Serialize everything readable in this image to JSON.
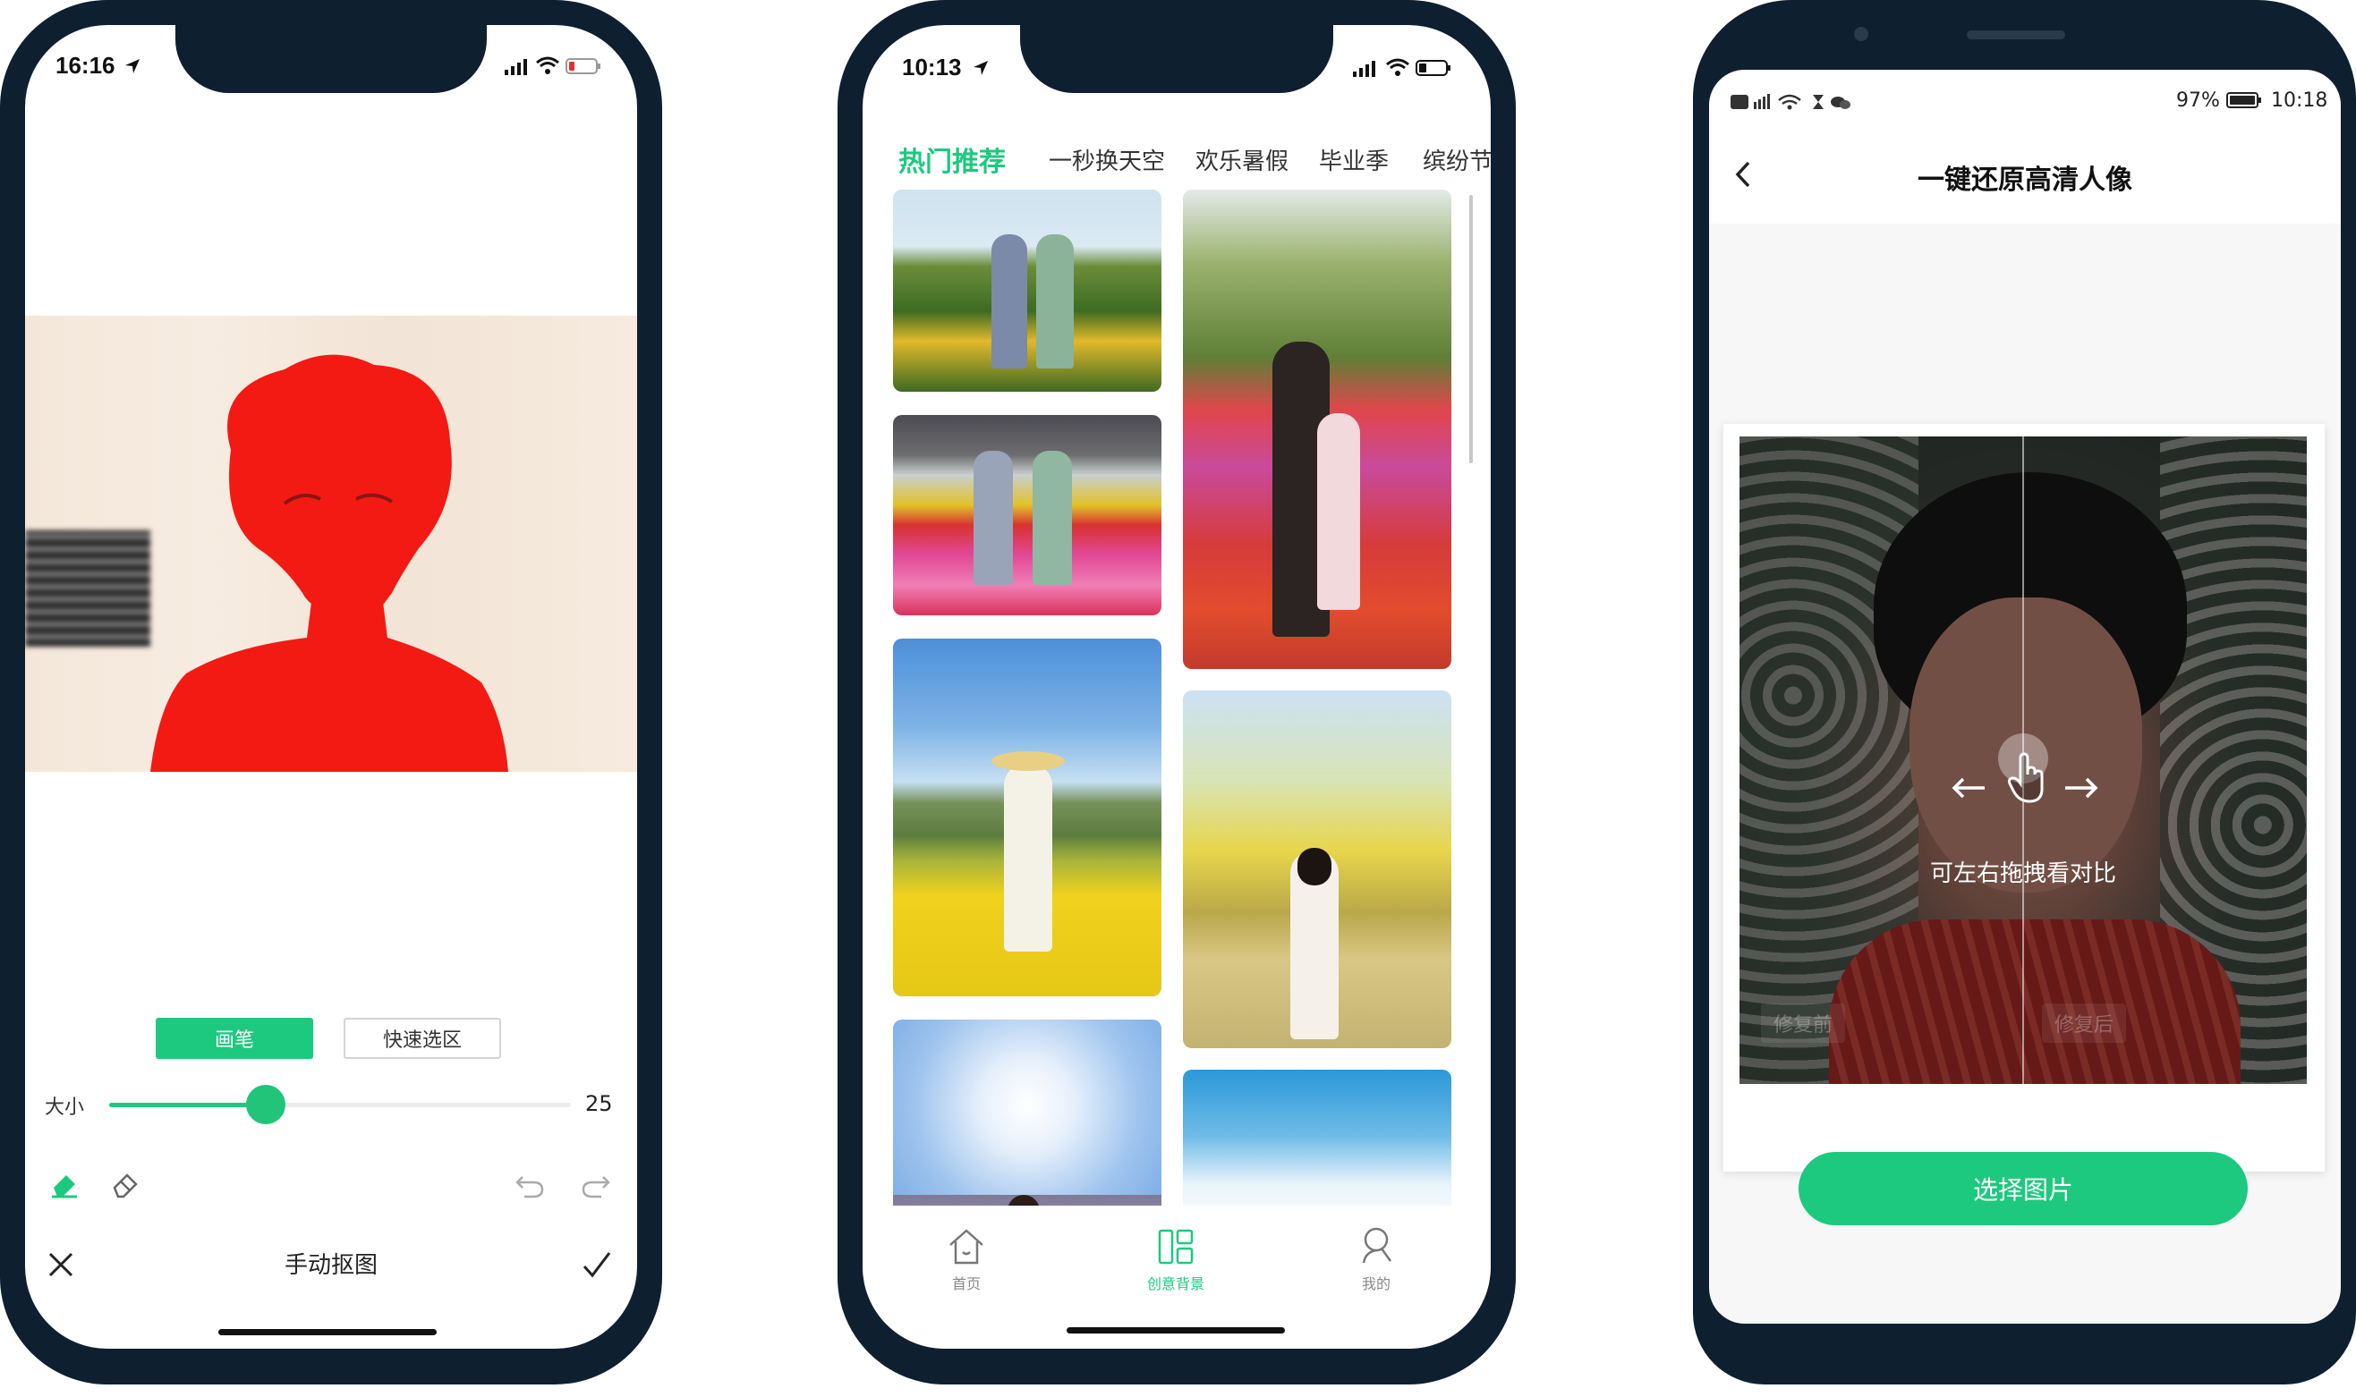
{
  "phone1": {
    "status": {
      "time": "16:16"
    },
    "mode_buttons": {
      "brush": "画笔",
      "quick_select": "快速选区"
    },
    "size_label": "大小",
    "size_value": "25",
    "size_fraction": 0.34,
    "title": "手动抠图",
    "icons": {
      "eraser": "eraser-icon",
      "eraser_outline": "eraser-outline-icon",
      "undo": "undo-icon",
      "redo": "redo-icon",
      "close": "close-icon",
      "confirm": "check-icon"
    },
    "colors": {
      "accent": "#1dc97f",
      "overlay": "#f31a14"
    }
  },
  "phone2": {
    "status": {
      "time": "10:13"
    },
    "tabs": [
      "热门推荐",
      "一秒换天空",
      "欢乐暑假",
      "毕业季",
      "缤纷节"
    ],
    "nav": [
      {
        "label": "首页",
        "icon": "home-icon"
      },
      {
        "label": "创意背景",
        "icon": "layout-icon"
      },
      {
        "label": "我的",
        "icon": "profile-icon"
      }
    ],
    "colors": {
      "accent": "#1dc97f"
    }
  },
  "phone3": {
    "status": {
      "time": "10:18",
      "battery": "97%"
    },
    "title": "一键还原高清人像",
    "hint": "可左右拖拽看对比",
    "before_label": "修复前",
    "after_label": "修复后",
    "select_button": "选择图片",
    "colors": {
      "accent": "#1dc97f"
    }
  }
}
